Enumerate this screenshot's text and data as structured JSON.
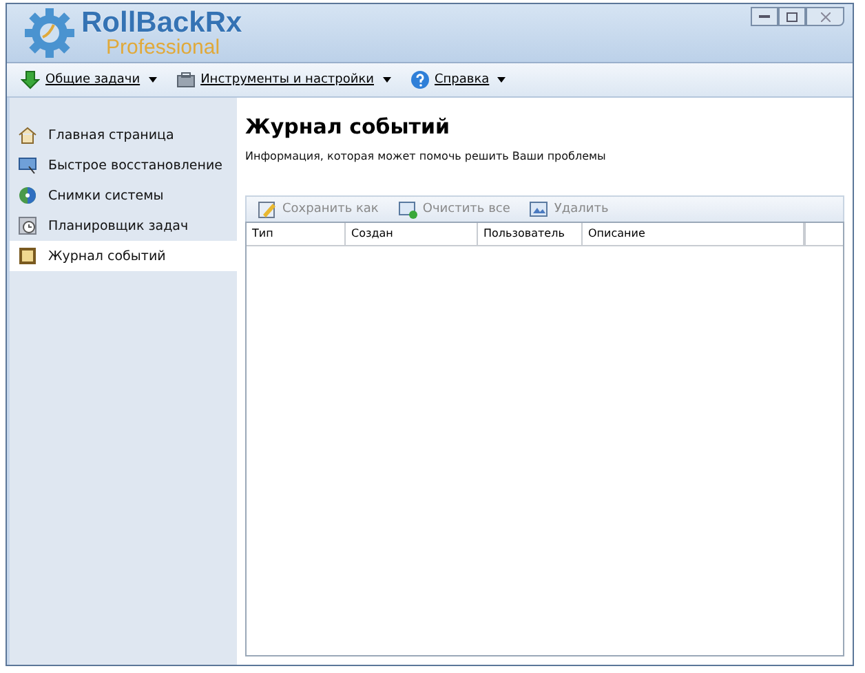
{
  "window": {
    "logo_title": "RollBackRx",
    "logo_subtitle": "Professional"
  },
  "menu": [
    {
      "label": "Общие задачи",
      "kind": "download"
    },
    {
      "label": "Инструменты и настройки",
      "kind": "tools"
    },
    {
      "label": "Справка",
      "kind": "help"
    }
  ],
  "sidebar": {
    "items": [
      {
        "label": "Главная страница",
        "kind": "home",
        "selected": false
      },
      {
        "label": "Быстрое восстановление",
        "kind": "restore",
        "selected": false
      },
      {
        "label": "Снимки системы",
        "kind": "snapshot",
        "selected": false
      },
      {
        "label": "Планировщик задач",
        "kind": "scheduler",
        "selected": false
      },
      {
        "label": "Журнал событий",
        "kind": "log",
        "selected": true
      }
    ]
  },
  "page": {
    "title": "Журнал событий",
    "subtitle": "Информация, которая может помочь решить Ваши проблемы"
  },
  "toolbar": [
    {
      "label": "Сохранить как",
      "kind": "save",
      "disabled": true
    },
    {
      "label": "Очистить все",
      "kind": "clear",
      "disabled": true
    },
    {
      "label": "Удалить",
      "kind": "delete",
      "disabled": true
    }
  ],
  "table": {
    "columns": [
      "Тип",
      "Создан",
      "Пользователь",
      "Описание"
    ]
  }
}
